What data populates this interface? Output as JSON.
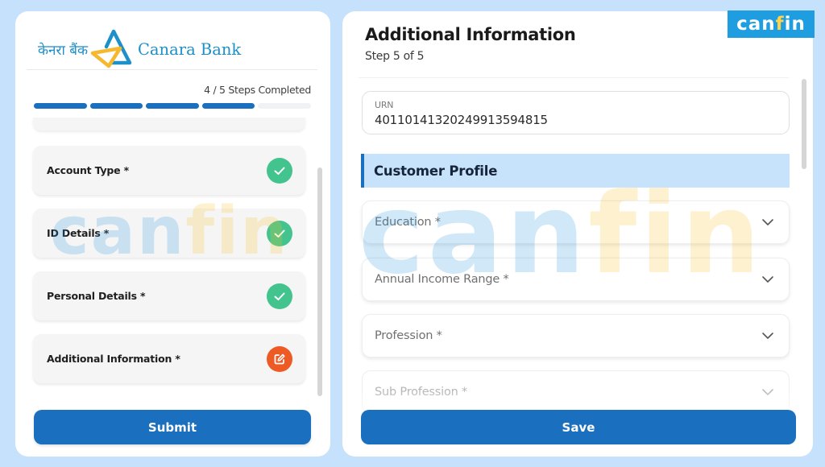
{
  "brand": {
    "bank_name_hindi": "केनरा बैंक",
    "bank_name_english": "Canara Bank",
    "badge_text_a": "can",
    "badge_text_b": "f",
    "badge_text_c": "in",
    "watermark_a": "can",
    "watermark_b": "fin"
  },
  "progress": {
    "label": "4 / 5 Steps Completed",
    "completed": 4,
    "total": 5
  },
  "steps": [
    {
      "label": "Account Type *",
      "status": "completed",
      "icon": "check-icon"
    },
    {
      "label": "ID Details *",
      "status": "completed",
      "icon": "check-icon"
    },
    {
      "label": "Personal Details *",
      "status": "completed",
      "icon": "check-icon"
    },
    {
      "label": "Additional Information *",
      "status": "in-progress",
      "icon": "edit-icon"
    }
  ],
  "submit_label": "Submit",
  "form": {
    "title": "Additional Information",
    "subtitle": "Step 5 of 5",
    "urn": {
      "label": "URN",
      "value": "40110141320249913594815"
    },
    "section_title": "Customer Profile",
    "fields": [
      {
        "placeholder": "Education *",
        "value": ""
      },
      {
        "placeholder": "Annual Income Range *",
        "value": ""
      },
      {
        "placeholder": "Profession *",
        "value": ""
      },
      {
        "placeholder": "Sub Profession *",
        "value": ""
      }
    ],
    "save_label": "Save"
  },
  "colors": {
    "primary": "#1a6fbf",
    "success": "#43c48e",
    "warning": "#ee5a24",
    "background": "#c5e1fb",
    "section_bg": "#c7e2fb",
    "badge_bg": "#1e9ee0"
  }
}
